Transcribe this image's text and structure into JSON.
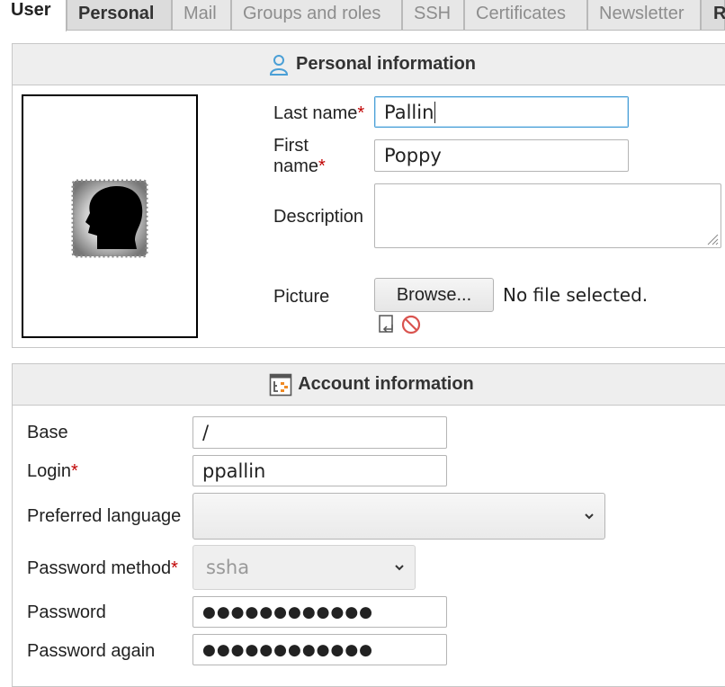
{
  "tabs": [
    {
      "label": "User",
      "active": true
    },
    {
      "label": "Personal"
    },
    {
      "label": "Mail"
    },
    {
      "label": "Groups and roles"
    },
    {
      "label": "SSH"
    },
    {
      "label": "Certificates"
    },
    {
      "label": "Newsletter"
    },
    {
      "label": "R"
    }
  ],
  "personal": {
    "title": "Personal information",
    "last_name_label": "Last name",
    "last_name_value": "Pallin",
    "first_name_label_1": "First",
    "first_name_label_2": "name",
    "first_name_value": "Poppy",
    "description_label": "Description",
    "description_value": "",
    "picture_label": "Picture",
    "browse_label": "Browse...",
    "file_status": "No file selected.",
    "required_mark": "*"
  },
  "account": {
    "title": "Account information",
    "base_label": "Base",
    "base_value": "/",
    "login_label": "Login",
    "login_value": "ppallin",
    "language_label": "Preferred language",
    "language_value": "",
    "method_label": "Password method",
    "method_value": "ssha",
    "password_label": "Password",
    "password_value": "●●●●●●●●●●●●",
    "password_again_label": "Password again",
    "password_again_value": "●●●●●●●●●●●●",
    "required_mark": "*"
  },
  "colors": {
    "accent": "#4a9fd6",
    "required": "#c00000",
    "header_bg": "#eeeeee"
  },
  "icons": {
    "personal_header": "person-icon",
    "account_header": "account-icon",
    "picture_upload": "upload-icon",
    "picture_remove": "remove-icon"
  }
}
